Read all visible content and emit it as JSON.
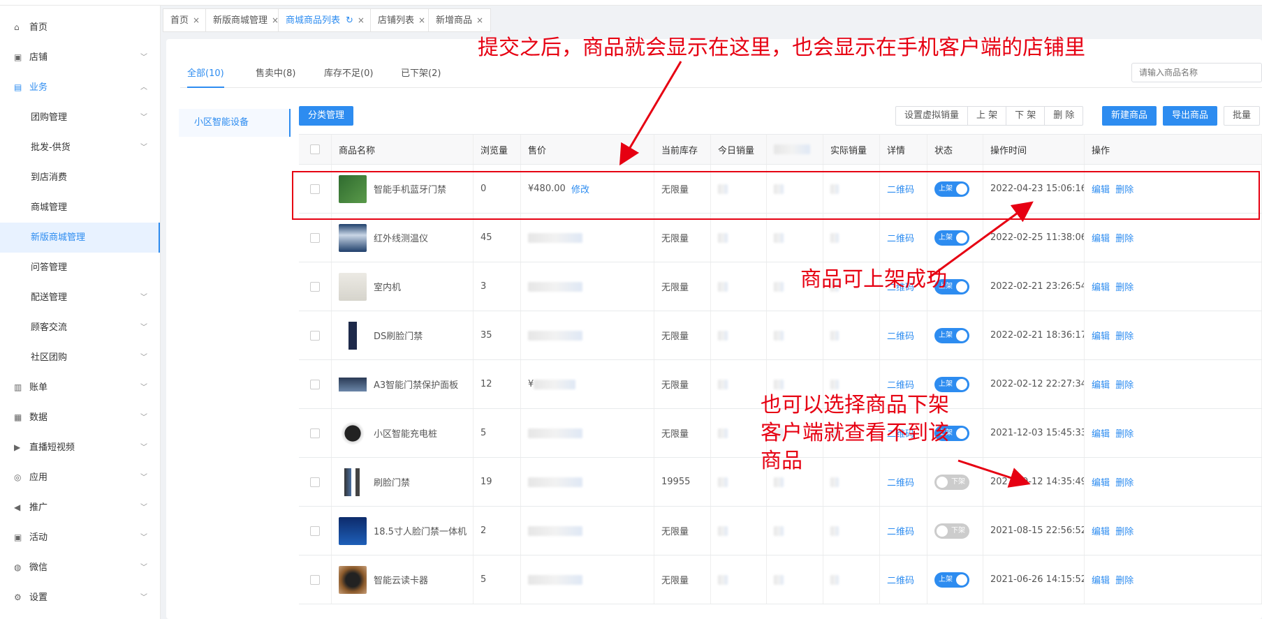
{
  "sidebar": {
    "items": [
      {
        "label": "首页",
        "icon": "home-icon",
        "has_chevron": false
      },
      {
        "label": "店铺",
        "icon": "shop-icon",
        "has_chevron": true
      },
      {
        "label": "业务",
        "icon": "business-icon",
        "has_chevron": true,
        "expanded": true
      },
      {
        "label": "团购管理",
        "sub": true,
        "has_chevron": true
      },
      {
        "label": "批发-供货",
        "sub": true,
        "has_chevron": true
      },
      {
        "label": "到店消费",
        "sub": true,
        "has_chevron": false
      },
      {
        "label": "商城管理",
        "sub": true,
        "has_chevron": false
      },
      {
        "label": "新版商城管理",
        "sub": true,
        "has_chevron": false,
        "selected": true
      },
      {
        "label": "问答管理",
        "sub": true,
        "has_chevron": false
      },
      {
        "label": "配送管理",
        "sub": true,
        "has_chevron": true
      },
      {
        "label": "顾客交流",
        "sub": true,
        "has_chevron": true
      },
      {
        "label": "社区团购",
        "sub": true,
        "has_chevron": true
      },
      {
        "label": "账单",
        "icon": "bill-icon",
        "has_chevron": true
      },
      {
        "label": "数据",
        "icon": "data-icon",
        "has_chevron": true
      },
      {
        "label": "直播短视频",
        "icon": "video-icon",
        "has_chevron": true
      },
      {
        "label": "应用",
        "icon": "app-icon",
        "has_chevron": true
      },
      {
        "label": "推广",
        "icon": "megaphone-icon",
        "has_chevron": true
      },
      {
        "label": "活动",
        "icon": "activity-icon",
        "has_chevron": true
      },
      {
        "label": "微信",
        "icon": "wechat-icon",
        "has_chevron": true
      },
      {
        "label": "设置",
        "icon": "gear-icon",
        "has_chevron": true
      }
    ]
  },
  "tabs": [
    {
      "label": "首页",
      "active": false
    },
    {
      "label": "新版商城管理",
      "active": false
    },
    {
      "label": "商城商品列表",
      "active": true
    },
    {
      "label": "店铺列表",
      "active": false
    },
    {
      "label": "新增商品",
      "active": false
    }
  ],
  "subtabs": [
    {
      "label": "全部(10)",
      "active": true
    },
    {
      "label": "售卖中(8)",
      "active": false
    },
    {
      "label": "库存不足(0)",
      "active": false
    },
    {
      "label": "已下架(2)",
      "active": false
    }
  ],
  "search": {
    "placeholder": "请输入商品名称"
  },
  "category": {
    "label": "小区智能设备"
  },
  "toolbar": {
    "category_manage": "分类管理",
    "set_virtual_sales": "设置虚拟销量",
    "shelve": "上 架",
    "unshelve": "下 架",
    "delete": "删 除",
    "new_product": "新建商品",
    "export_product": "导出商品",
    "batch": "批量"
  },
  "table": {
    "headers": [
      "商品名称",
      "浏览量",
      "售价",
      "当前库存",
      "今日销量",
      "实际销量",
      "详情",
      "状态",
      "操作时间",
      "操作"
    ],
    "rows": [
      {
        "name": "智能手机蓝牙门禁",
        "views": "0",
        "price": "¥480.00",
        "price_edit": "修改",
        "stock": "无限量",
        "detail": "二维码",
        "status": "上架",
        "on": true,
        "time": "2022-04-23 15:06:16",
        "thumb": "pcb"
      },
      {
        "name": "红外线测温仪",
        "views": "45",
        "price": "",
        "stock": "无限量",
        "detail": "二维码",
        "status": "上架",
        "on": true,
        "time": "2022-02-25 11:38:06",
        "thumb": "kiosk"
      },
      {
        "name": "室内机",
        "views": "3",
        "price": "",
        "stock": "无限量",
        "detail": "二维码",
        "status": "上架",
        "on": true,
        "time": "2022-02-21 23:26:54",
        "thumb": "indoor"
      },
      {
        "name": "DS刷脸门禁",
        "views": "35",
        "price": "",
        "stock": "无限量",
        "detail": "二维码",
        "status": "上架",
        "on": true,
        "time": "2022-02-21 18:36:17",
        "thumb": "phone"
      },
      {
        "name": "A3智能门禁保护面板",
        "views": "12",
        "price": "¥",
        "stock": "无限量",
        "detail": "二维码",
        "status": "上架",
        "on": true,
        "time": "2022-02-12 22:27:34",
        "thumb": "panel"
      },
      {
        "name": "小区智能充电桩",
        "views": "5",
        "price": "",
        "stock": "无限量",
        "detail": "二维码",
        "status": "上架",
        "on": true,
        "time": "2021-12-03 15:45:33",
        "thumb": "charger"
      },
      {
        "name": "刷脸门禁",
        "views": "19",
        "price": "",
        "stock": "19955",
        "detail": "二维码",
        "status": "下架",
        "on": false,
        "time": "2021-09-12 14:35:49",
        "thumb": "faceid"
      },
      {
        "name": "18.5寸人脸门禁一体机",
        "views": "2",
        "price": "",
        "stock": "无限量",
        "detail": "二维码",
        "status": "下架",
        "on": false,
        "time": "2021-08-15 22:56:52",
        "thumb": "screen"
      },
      {
        "name": "智能云读卡器",
        "views": "5",
        "price": "",
        "stock": "无限量",
        "detail": "二维码",
        "status": "上架",
        "on": true,
        "time": "2021-06-26 14:15:52",
        "thumb": "reader"
      }
    ],
    "actions": {
      "edit": "编辑",
      "delete": "删除"
    }
  },
  "annotations": {
    "top": "提交之后，商品就会显示在这里，也会显示在手机客户端的店铺里",
    "middle": "商品可上架成功",
    "bottom_line1": "也可以选择商品下架",
    "bottom_line2": "客户端就查看不到该",
    "bottom_line3": "商品"
  },
  "colors": {
    "accent": "#2d8cf0",
    "annotation": "#e60012"
  }
}
